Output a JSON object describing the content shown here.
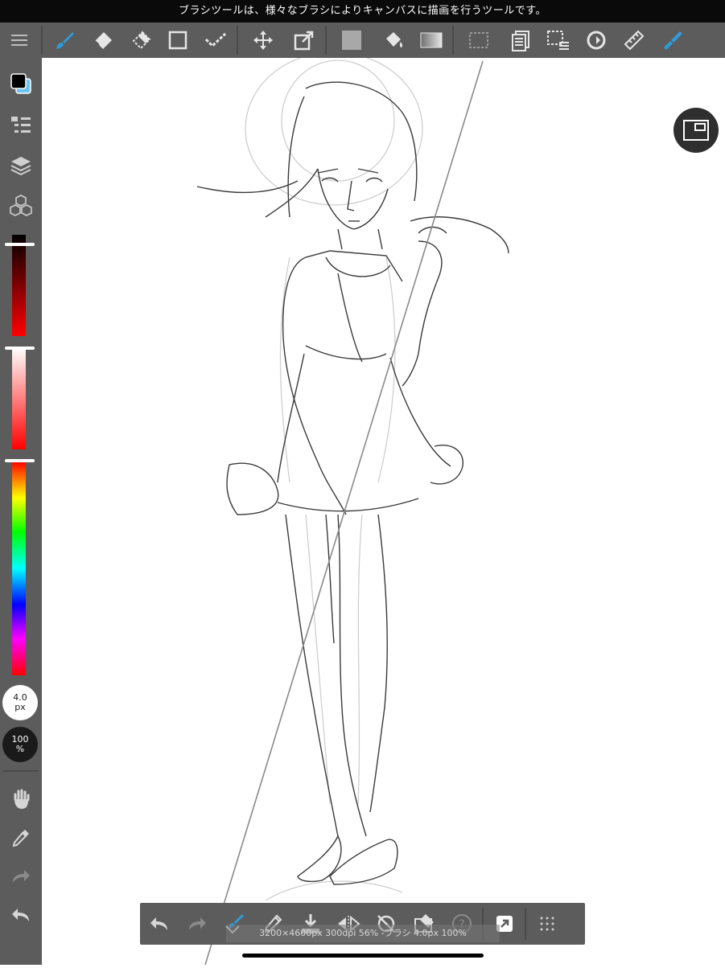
{
  "status_bar": {
    "message": "ブラシツールは、様々なブラシによりキャンバスに描画を行うツールです。"
  },
  "toolbar": {
    "items": [
      {
        "name": "menu-icon"
      },
      {
        "name": "brush-icon",
        "active": true
      },
      {
        "name": "eraser-icon"
      },
      {
        "name": "blur-icon"
      },
      {
        "name": "shape-icon"
      },
      {
        "name": "select-pen-icon"
      },
      {
        "name": "move-icon"
      },
      {
        "name": "transform-icon"
      },
      {
        "name": "fill-icon"
      },
      {
        "name": "bucket-icon"
      },
      {
        "name": "gradient-icon"
      },
      {
        "name": "select-icon"
      },
      {
        "name": "copy-layer-icon"
      },
      {
        "name": "select-menu-icon"
      },
      {
        "name": "rotate-icon"
      },
      {
        "name": "ruler-icon"
      },
      {
        "name": "material-icon"
      }
    ]
  },
  "sidebar": {
    "foreground_color": "#000000",
    "background_color": "#6cc4f0",
    "brush_size": {
      "value": "4.0",
      "unit": "px"
    },
    "opacity": {
      "value": "100",
      "unit": "%"
    },
    "items": [
      {
        "name": "brush-list-icon"
      },
      {
        "name": "layers-icon"
      },
      {
        "name": "material-cubes-icon"
      },
      {
        "name": "hand-icon"
      },
      {
        "name": "eyedropper-icon"
      },
      {
        "name": "redo-icon"
      },
      {
        "name": "undo-icon"
      }
    ]
  },
  "sliders": [
    {
      "name": "brightness-slider",
      "level": 0.92
    },
    {
      "name": "saturation-slider",
      "level": 0.98
    },
    {
      "name": "hue-slider",
      "level": 0.99
    }
  ],
  "accent_color": "#2f9bd8",
  "bottom_bar": {
    "items": [
      {
        "name": "undo-icon"
      },
      {
        "name": "redo-icon"
      },
      {
        "name": "brush-settings-icon"
      },
      {
        "name": "pen-icon"
      },
      {
        "name": "download-icon"
      },
      {
        "name": "flip-icon"
      },
      {
        "name": "no-rotate-icon"
      },
      {
        "name": "eraser-select-icon"
      },
      {
        "name": "help-icon"
      },
      {
        "name": "export-icon"
      },
      {
        "name": "grid-menu-icon"
      }
    ],
    "status": "3200×4600px 300dpi 56% -ブラシ 4.0px 100%"
  },
  "navigator": {
    "name": "navigator-icon"
  }
}
